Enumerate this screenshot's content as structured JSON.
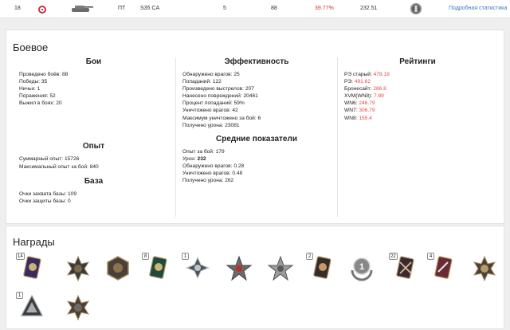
{
  "top_row": {
    "index": "18",
    "class": "ПТ",
    "tank": "S35 CA",
    "battles_col": "5",
    "value2": "88",
    "winrate": "39.77%",
    "value3": "232.51",
    "link": "Подробная статистика"
  },
  "battle": {
    "title": "Боевое",
    "battles": {
      "heading": "Бои",
      "rows": [
        {
          "label": "Проведено боёв:",
          "value": "88"
        },
        {
          "label": "Победы:",
          "value": "35"
        },
        {
          "label": "Ничьи:",
          "value": "1"
        },
        {
          "label": "Поражения:",
          "value": "52"
        },
        {
          "label": "Выжил в боях:",
          "value": "20"
        }
      ]
    },
    "experience": {
      "heading": "Опыт",
      "rows": [
        {
          "label": "Суммарный опыт:",
          "value": "15726"
        },
        {
          "label": "Максимальный опыт за бой:",
          "value": "840"
        }
      ]
    },
    "base": {
      "heading": "База",
      "rows": [
        {
          "label": "Очки захвата базы:",
          "value": "109"
        },
        {
          "label": "Очки защиты базы:",
          "value": "0"
        }
      ]
    },
    "efficiency": {
      "heading": "Эффективность",
      "rows": [
        {
          "label": "Обнаружено врагов:",
          "value": "25"
        },
        {
          "label": "Попаданий:",
          "value": "122"
        },
        {
          "label": "Произведено выстрелов:",
          "value": "207"
        },
        {
          "label": "Нанесено повреждений:",
          "value": "20461"
        },
        {
          "label": "Процент попаданий:",
          "value": "59%"
        },
        {
          "label": "Уничтожено врагов:",
          "value": "42"
        },
        {
          "label": "Максимум уничтожено за бой:",
          "value": "6"
        },
        {
          "label": "Получено урона:",
          "value": "23081"
        }
      ]
    },
    "averages": {
      "heading": "Средние показатели",
      "rows": [
        {
          "label": "Опыт за бой:",
          "value": "179"
        },
        {
          "label": "Урон:",
          "value": "232"
        },
        {
          "label": "Обнаружено врагов:",
          "value": "0.28"
        },
        {
          "label": "Уничтожено врагов:",
          "value": "0.48"
        },
        {
          "label": "Получено урона:",
          "value": "262"
        }
      ]
    },
    "ratings": {
      "heading": "Рейтинги",
      "rows": [
        {
          "label": "РЭ старый:",
          "value": "478.19"
        },
        {
          "label": "РЭ:",
          "value": "491.62"
        },
        {
          "label": "Бронесайт:",
          "value": "286.8"
        },
        {
          "label": "XVM(WN8):",
          "value": "7.89"
        },
        {
          "label": "WN6:",
          "value": "246.79"
        },
        {
          "label": "WN7:",
          "value": "306.79"
        },
        {
          "label": "WN8:",
          "value": "155.4"
        }
      ]
    }
  },
  "awards": {
    "title": "Награды",
    "items": [
      {
        "name": "medal-card-purple",
        "count": "14"
      },
      {
        "name": "medal-cross-dark",
        "count": ""
      },
      {
        "name": "medal-hexagon",
        "count": ""
      },
      {
        "name": "medal-card-green",
        "count": "8"
      },
      {
        "name": "medal-cross-wings",
        "count": "1"
      },
      {
        "name": "medal-star-red",
        "count": ""
      },
      {
        "name": "medal-star-silver",
        "count": ""
      },
      {
        "name": "medal-card-dark",
        "count": "2"
      },
      {
        "name": "medal-wreath-one",
        "count": ""
      },
      {
        "name": "medal-card-swords",
        "count": "22"
      },
      {
        "name": "medal-card-red",
        "count": "4"
      },
      {
        "name": "medal-cross-bronze",
        "count": ""
      },
      {
        "name": "medal-triangle",
        "count": "1"
      },
      {
        "name": "medal-cross-small",
        "count": ""
      }
    ],
    "wreath_number": "1"
  },
  "colors": {
    "red_value": "#e24a40",
    "link": "#3a7bbf"
  }
}
